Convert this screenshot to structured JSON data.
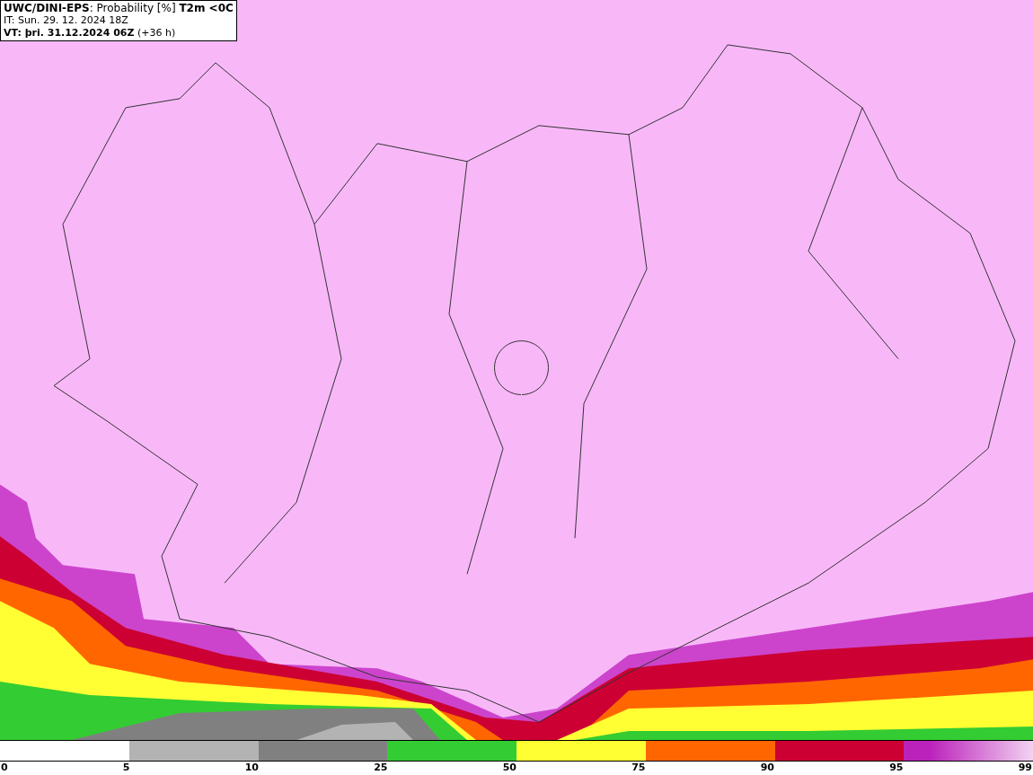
{
  "header": {
    "lines": [
      "**UWC/DINI-EPS**: Probability [%] **T2m <0C**",
      "IT: Sun. 29. 12. 2024 18Z",
      "**VT: þri. 31.12.2024 06Z** (+36 h)"
    ]
  },
  "legend": {
    "bins": [
      {
        "color": "#ffffff"
      },
      {
        "color": "#b3b3b3"
      },
      {
        "color": "#808080"
      },
      {
        "color": "#33cc33"
      },
      {
        "color": "#ffff33"
      },
      {
        "color": "#ff6600"
      },
      {
        "color": "#cc0033"
      },
      {
        "color": "#bb22bb",
        "kind": "gradient"
      }
    ],
    "ticks": [
      "0",
      "5",
      "10",
      "25",
      "50",
      "75",
      "90",
      "95",
      "99"
    ]
  }
}
